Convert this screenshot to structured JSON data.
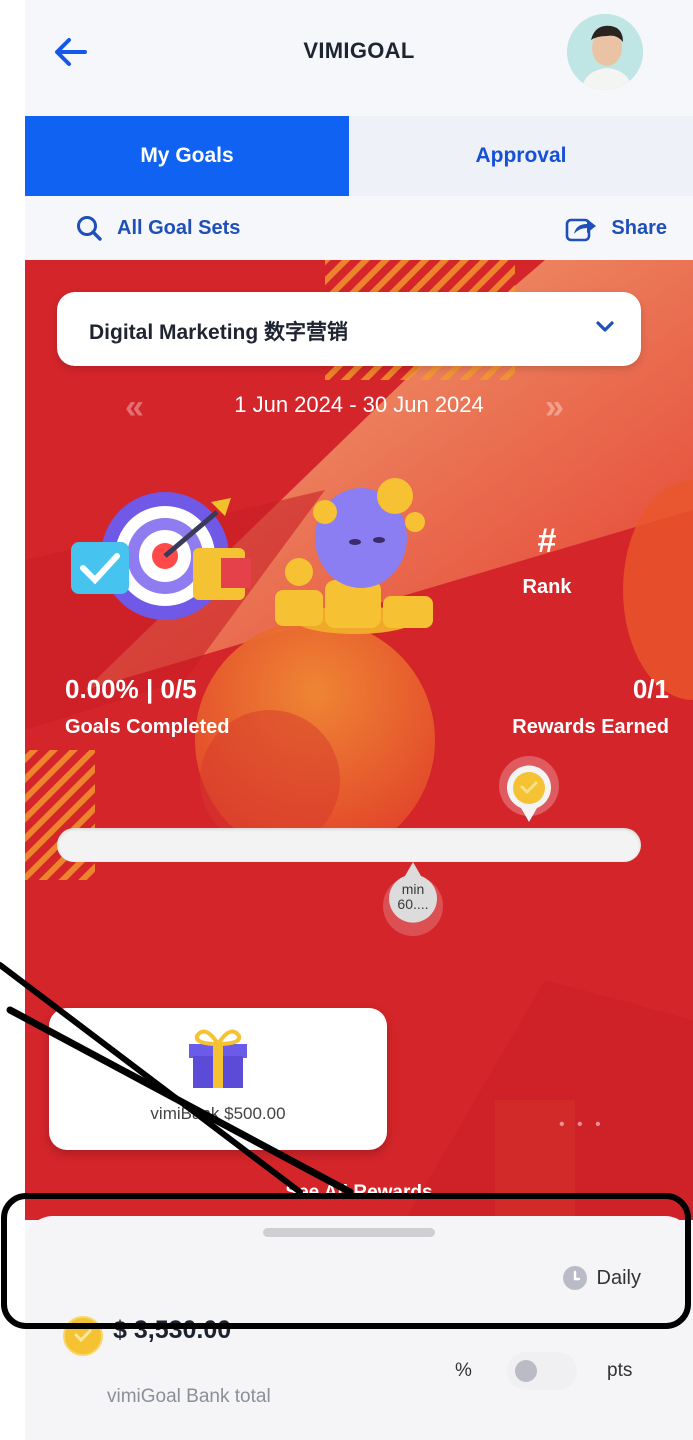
{
  "header": {
    "title": "VIMIGOAL"
  },
  "tabs": [
    {
      "label": "My Goals",
      "active": true
    },
    {
      "label": "Approval",
      "active": false
    }
  ],
  "subbar": {
    "all_goal_sets": "All Goal Sets",
    "share": "Share"
  },
  "goal_set": {
    "selected": "Digital Marketing 数字营销",
    "date_range": "1 Jun 2024 - 30 Jun 2024"
  },
  "rank": {
    "symbol": "#",
    "label": "Rank"
  },
  "stats": {
    "goals_value": "0.00% | 0/5",
    "goals_label": "Goals Completed",
    "rewards_value": "0/1",
    "rewards_label": "Rewards Earned"
  },
  "progress": {
    "fraction": 0.0,
    "min_line1": "min",
    "min_line2": "60...."
  },
  "reward_card": {
    "label": "vimiBank $500.00"
  },
  "see_all": "See All Rewards",
  "bottom_sheet": {
    "period": "Daily",
    "bank_amount": "$ 3,530.00",
    "bank_label": "vimiGoal Bank total",
    "pct_label": "%",
    "pts_label": "pts"
  },
  "colors": {
    "primary_blue": "#0f62f2",
    "hero_red": "#d4252a",
    "coin_gold": "#f4c233"
  }
}
